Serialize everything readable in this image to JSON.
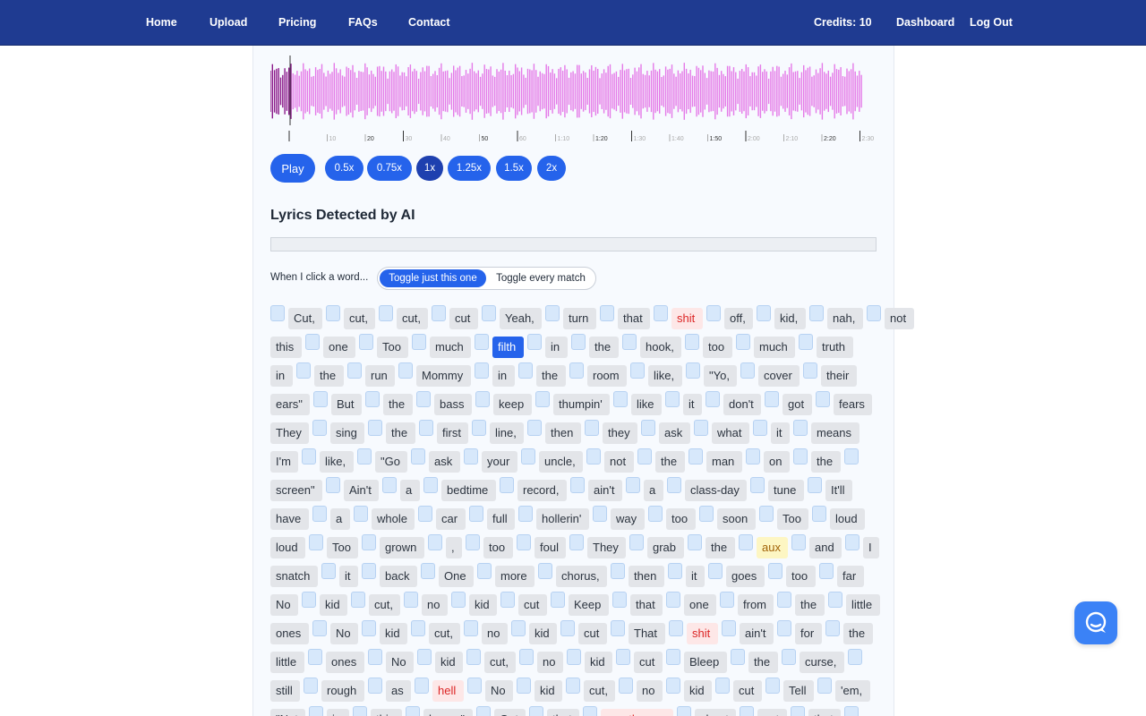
{
  "nav": {
    "home": "Home",
    "upload": "Upload",
    "pricing": "Pricing",
    "faqs": "FAQs",
    "contact": "Contact",
    "credits": "Credits: 10",
    "dashboard": "Dashboard",
    "logout": "Log Out"
  },
  "timeline": [
    "10",
    "20",
    "30",
    "40",
    "50",
    "60",
    "1:10",
    "1:20",
    "1:30",
    "1:40",
    "1:50",
    "2:00",
    "2:10",
    "2:20",
    "2:30"
  ],
  "player": {
    "play": "Play",
    "speeds": [
      "0.5x",
      "0.75x",
      "1x",
      "1.25x",
      "1.5x",
      "2x"
    ],
    "active_speed": "1x"
  },
  "lyrics_heading": "Lyrics Detected by AI",
  "click_mode": {
    "label": "When I click a word...",
    "just_this": "Toggle just this one",
    "every_match": "Toggle every match"
  },
  "lyric_lines": [
    [
      "Cut,",
      "cut,",
      "cut,",
      "cut",
      "Yeah,",
      "turn",
      "that",
      "shit",
      "off,",
      "kid,",
      "nah,",
      "not"
    ],
    [
      "this",
      "one",
      "Too",
      "much",
      "filth",
      "in",
      "the",
      "hook,",
      "too",
      "much",
      "truth"
    ],
    [
      "in",
      "the",
      "run",
      "Mommy",
      "in",
      "the",
      "room",
      "like,",
      "\"Yo,",
      "cover",
      "their"
    ],
    [
      "ears\"",
      "But",
      "the",
      "bass",
      "keep",
      "thumpin'",
      "like",
      "it",
      "don't",
      "got",
      "fears"
    ],
    [
      "They",
      "sing",
      "the",
      "first",
      "line,",
      "then",
      "they",
      "ask",
      "what",
      "it",
      "means"
    ],
    [
      "I'm",
      "like,",
      "\"Go",
      "ask",
      "your",
      "uncle,",
      "not",
      "the",
      "man",
      "on",
      "the"
    ],
    [
      "screen\"",
      "Ain't",
      "a",
      "bedtime",
      "record,",
      "ain't",
      "a",
      "class-day",
      "tune",
      "It'll"
    ],
    [
      "have",
      "a",
      "whole",
      "car",
      "full",
      "hollerin'",
      "way",
      "too",
      "soon",
      "Too",
      "loud"
    ],
    [
      "loud",
      "Too",
      "grown",
      ",",
      "too",
      "foul",
      "They",
      "grab",
      "the",
      "aux",
      "and",
      "I"
    ],
    [
      "snatch",
      "it",
      "back",
      "One",
      "more",
      "chorus,",
      "then",
      "it",
      "goes",
      "too",
      "far"
    ],
    [
      "No",
      "kid",
      "cut,",
      "no",
      "kid",
      "cut",
      "Keep",
      "that",
      "one",
      "from",
      "the",
      "little"
    ],
    [
      "ones",
      "No",
      "kid",
      "cut,",
      "no",
      "kid",
      "cut",
      "That",
      "shit",
      "ain't",
      "for",
      "the"
    ],
    [
      "little",
      "ones",
      "No",
      "kid",
      "cut,",
      "no",
      "kid",
      "cut",
      "Bleep",
      "the",
      "curse,"
    ],
    [
      "still",
      "rough",
      "as",
      "hell",
      "No",
      "kid",
      "cut,",
      "no",
      "kid",
      "cut",
      "Tell",
      "'em,"
    ],
    [
      "\"Not",
      "in",
      "this",
      "house\"",
      "Got",
      "that",
      "mouthy ass",
      "chant",
      "got",
      "that"
    ]
  ],
  "flagged_red": [
    "shit",
    "hell",
    "mouthy ass"
  ],
  "flagged_yellow": [
    "aux"
  ],
  "selected_word": "filth",
  "colors": {
    "nav_bg": "#1f3b91",
    "accent": "#2563eb",
    "waveform": "#e47ae8",
    "waveform_played": "#8b1a8b",
    "flag_red": "#dc2626",
    "flag_yellow_bg": "#fdf6c3"
  },
  "icons": {
    "chat": "chat-bubble-icon"
  }
}
